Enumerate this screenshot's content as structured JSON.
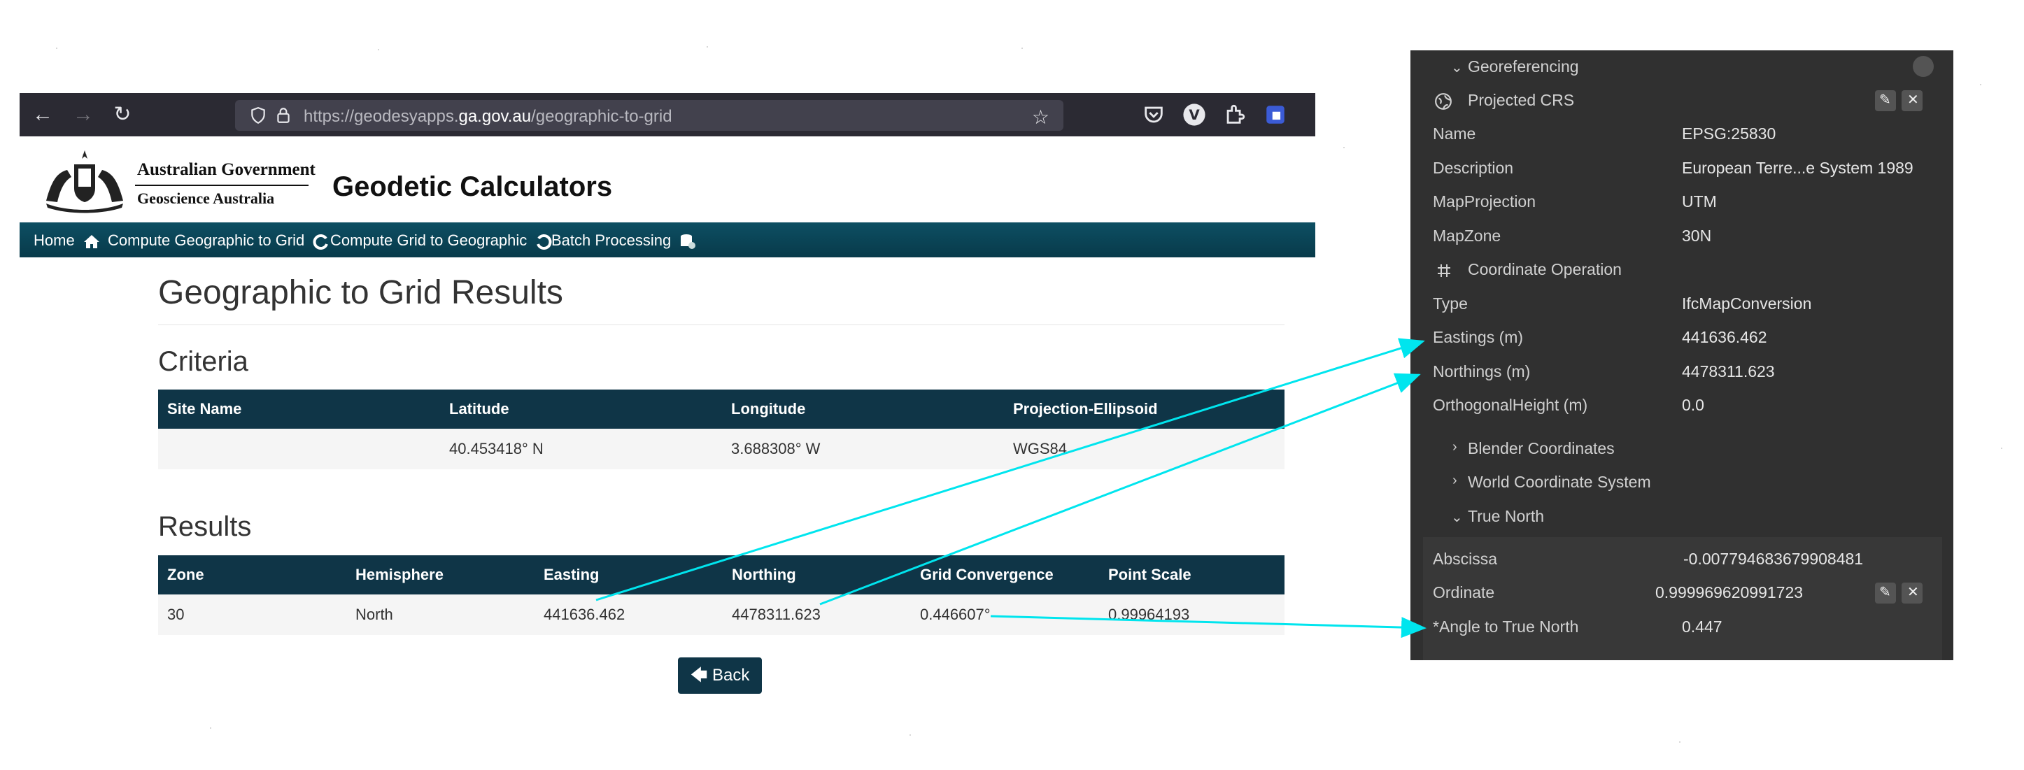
{
  "browser": {
    "url_prefix": "https://geodesyapps.",
    "url_domain": "ga.gov.au",
    "url_suffix": "/geographic-to-grid",
    "extension_v_label": "V"
  },
  "site": {
    "gov_name_line1": "Australian Government",
    "gov_name_line2": "Geoscience Australia",
    "title": "Geodetic Calculators",
    "nav": [
      {
        "label": "Home"
      },
      {
        "label": "Compute Geographic to Grid"
      },
      {
        "label": "Compute Grid to Geographic"
      },
      {
        "label": "Batch Processing"
      }
    ],
    "page_title": "Geographic to Grid Results",
    "criteria": {
      "heading": "Criteria",
      "headers": [
        "Site Name",
        "Latitude",
        "Longitude",
        "Projection-Ellipsoid"
      ],
      "row": [
        "",
        "40.453418° N",
        "3.688308° W",
        "WGS84"
      ]
    },
    "results": {
      "heading": "Results",
      "headers": [
        "Zone",
        "Hemisphere",
        "Easting",
        "Northing",
        "Grid Convergence",
        "Point Scale"
      ],
      "row": [
        "30",
        "North",
        "441636.462",
        "4478311.623",
        "0.446607°",
        "0.99964193"
      ]
    },
    "back_label": "Back"
  },
  "panel": {
    "georeferencing": "Georeferencing",
    "projected_crs": "Projected CRS",
    "crs_rows": [
      {
        "label": "Name",
        "value": "EPSG:25830"
      },
      {
        "label": "Description",
        "value": "European Terre...e System 1989"
      },
      {
        "label": "MapProjection",
        "value": "UTM"
      },
      {
        "label": "MapZone",
        "value": "30N"
      }
    ],
    "coordinate_operation": "Coordinate Operation",
    "op_rows": [
      {
        "label": "Type",
        "value": "IfcMapConversion"
      },
      {
        "label": "Eastings (m)",
        "value": "441636.462"
      },
      {
        "label": "Northings (m)",
        "value": "4478311.623"
      },
      {
        "label": "OrthogonalHeight (m)",
        "value": "0.0"
      }
    ],
    "blender_coordinates": "Blender Coordinates",
    "world_coordinate_system": "World Coordinate System",
    "true_north": "True North",
    "abscissa_label": "Abscissa",
    "abscissa_value": "-0.007794683679908481",
    "ordinate_label": "Ordinate",
    "ordinate_value": "0.999969620991723",
    "angle_label": "*Angle to True North",
    "angle_value": "0.447"
  },
  "colors": {
    "annotation_arrow": "#00e5ee",
    "table_header": "#0f3547",
    "panel_bg": "#303030"
  }
}
